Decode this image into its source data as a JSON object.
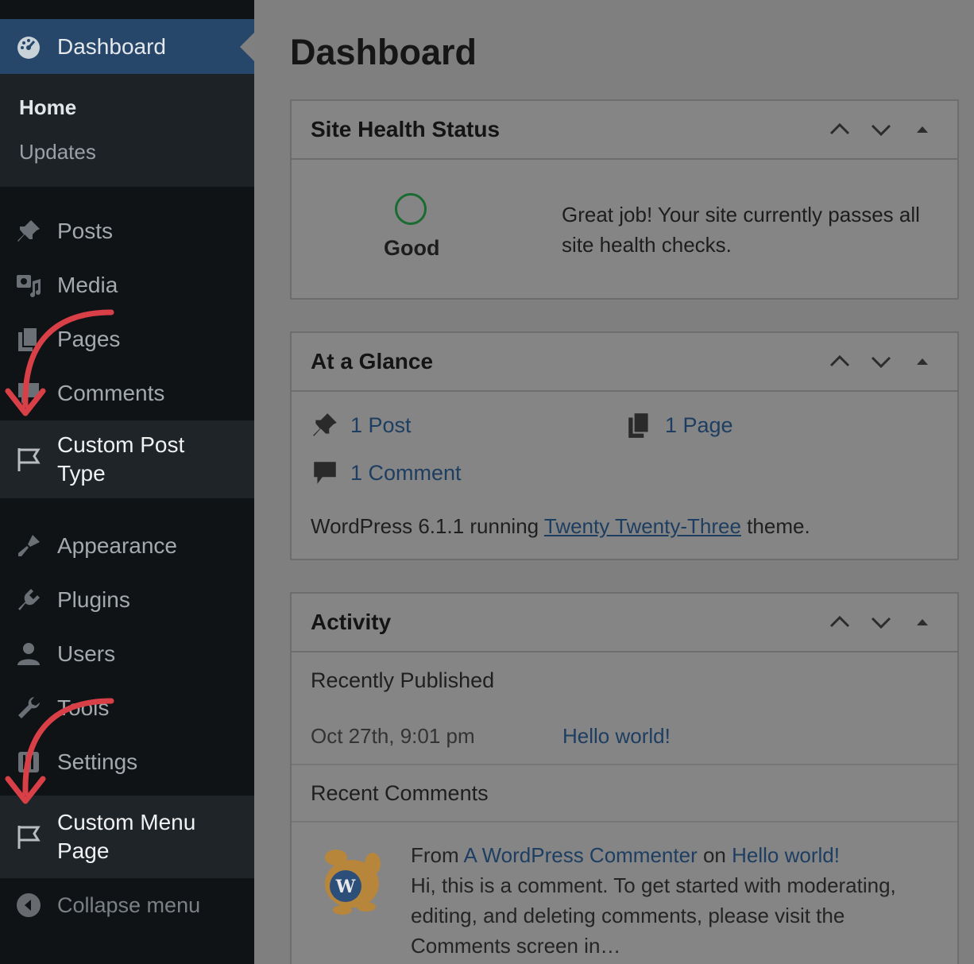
{
  "sidebar": {
    "dashboard": "Dashboard",
    "submenu": [
      "Home",
      "Updates"
    ],
    "items": [
      {
        "label": "Posts",
        "icon": "pin-icon"
      },
      {
        "label": "Media",
        "icon": "media-icon"
      },
      {
        "label": "Pages",
        "icon": "pages-icon"
      },
      {
        "label": "Comments",
        "icon": "comments-icon"
      }
    ],
    "custom_post_type": [
      "Custom Post",
      "Type"
    ],
    "items2": [
      {
        "label": "Appearance",
        "icon": "brush-icon"
      },
      {
        "label": "Plugins",
        "icon": "plugin-icon"
      },
      {
        "label": "Users",
        "icon": "user-icon"
      },
      {
        "label": "Tools",
        "icon": "wrench-icon"
      },
      {
        "label": "Settings",
        "icon": "settings-icon"
      }
    ],
    "custom_menu_page": [
      "Custom Menu",
      "Page"
    ],
    "collapse": "Collapse menu"
  },
  "main": {
    "title": "Dashboard",
    "site_health": {
      "title": "Site Health Status",
      "status": "Good",
      "message": "Great job! Your site currently passes all site health checks."
    },
    "glance": {
      "title": "At a Glance",
      "posts": "1 Post",
      "pages": "1 Page",
      "comments": "1 Comment",
      "footer_prefix": "WordPress 6.1.1 running ",
      "theme": "Twenty Twenty-Three",
      "footer_suffix": " theme."
    },
    "activity": {
      "title": "Activity",
      "recently_published": "Recently Published",
      "post_date": "Oct 27th, 9:01 pm",
      "post_title": "Hello world!",
      "recent_comments": "Recent Comments",
      "from": "From ",
      "author": "A WordPress Commenter",
      "on": " on ",
      "comment_post": "Hello world!",
      "comment_text": "Hi, this is a comment. To get started with moderating, editing, and deleting comments, please visit the Comments screen in…"
    }
  },
  "colors": {
    "sidebar_bg": "#101316",
    "active_bg": "#26466a",
    "arrow": "#d93f47",
    "link": "#1e3e61"
  }
}
